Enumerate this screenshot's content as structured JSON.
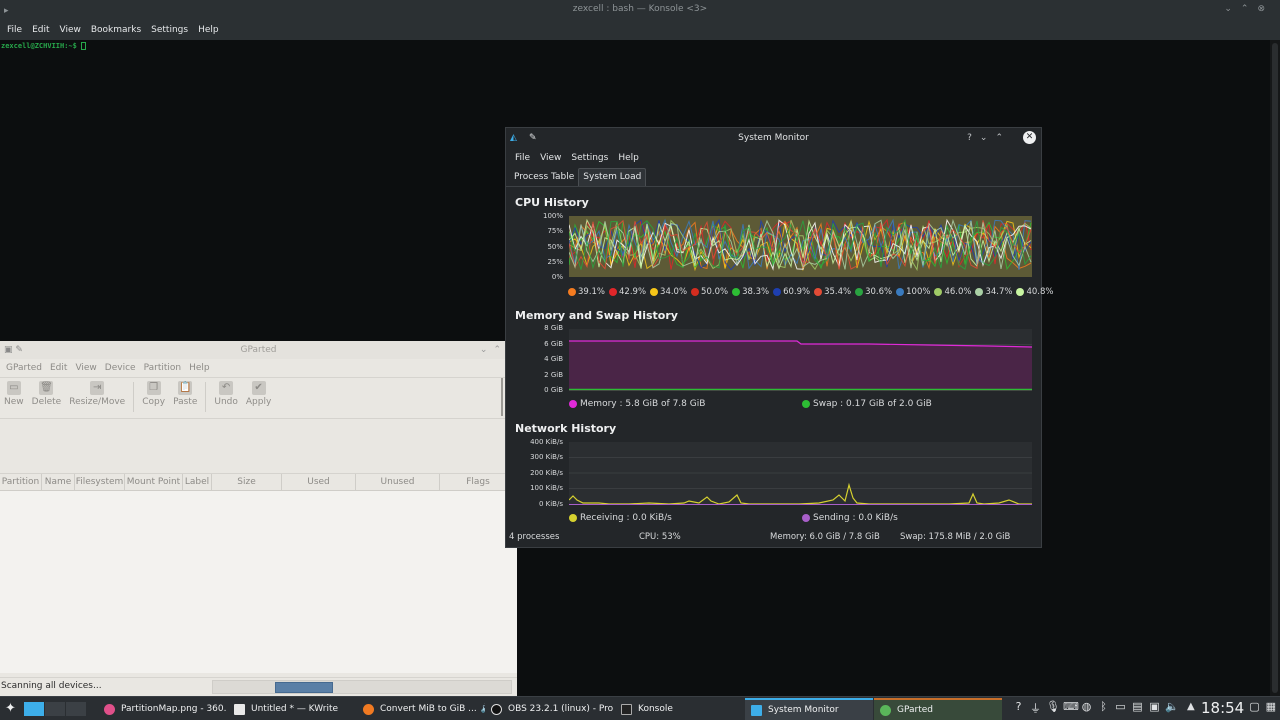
{
  "konsole": {
    "title": "zexcell : bash — Konsole <3>",
    "menu": [
      "File",
      "Edit",
      "View",
      "Bookmarks",
      "Settings",
      "Help"
    ],
    "prompt": "zexcell@ZCHVIIH:~$"
  },
  "gparted": {
    "title": "GParted",
    "menu": [
      "GParted",
      "Edit",
      "View",
      "Device",
      "Partition",
      "Help"
    ],
    "toolbar": [
      "New",
      "Delete",
      "Resize/Move",
      "Copy",
      "Paste",
      "Undo",
      "Apply"
    ],
    "columns": [
      "Partition",
      "Name",
      "Filesystem",
      "Mount Point",
      "Label",
      "Size",
      "Used",
      "Unused",
      "Flags"
    ],
    "status": "Scanning all devices..."
  },
  "sysmon": {
    "title": "System Monitor",
    "menu": [
      "File",
      "View",
      "Settings",
      "Help"
    ],
    "tabs": [
      "Process Table",
      "System Load"
    ],
    "cpu": {
      "title": "CPU History",
      "yticks": [
        "100%",
        "75%",
        "50%",
        "25%",
        "0%"
      ],
      "legend": [
        {
          "label": "39.1%",
          "color": "#f47b20"
        },
        {
          "label": "42.9%",
          "color": "#e0262a"
        },
        {
          "label": "34.0%",
          "color": "#f5c518"
        },
        {
          "label": "50.0%",
          "color": "#d42d1f"
        },
        {
          "label": "38.3%",
          "color": "#2dbd34"
        },
        {
          "label": "60.9%",
          "color": "#1e3fb0"
        },
        {
          "label": "35.4%",
          "color": "#e34b36"
        },
        {
          "label": "30.6%",
          "color": "#29a340"
        },
        {
          "label": "100%",
          "color": "#3a7bbf"
        },
        {
          "label": "46.0%",
          "color": "#9fca66"
        },
        {
          "label": "34.7%",
          "color": "#aad0a5"
        },
        {
          "label": "40.8%",
          "color": "#c8f5a1"
        }
      ]
    },
    "memory": {
      "title": "Memory and Swap History",
      "yticks": [
        "8 GiB",
        "6 GiB",
        "4 GiB",
        "2 GiB",
        "0 GiB"
      ],
      "memory_label": "Memory : 5.8 GiB of 7.8 GiB",
      "swap_label": "Swap : 0.17 GiB of 2.0 GiB",
      "memory_color": "#e02ad8",
      "swap_color": "#2dbd34"
    },
    "network": {
      "title": "Network History",
      "yticks": [
        "400 KiB/s",
        "300 KiB/s",
        "200 KiB/s",
        "100 KiB/s",
        "0 KiB/s"
      ],
      "receiving_label": "Receiving : 0.0 KiB/s",
      "sending_label": "Sending : 0.0 KiB/s",
      "receiving_color": "#d6d12f",
      "sending_color": "#a85fc9"
    },
    "status": {
      "processes": "4 processes",
      "cpu": "CPU: 53%",
      "memory": "Memory: 6.0 GiB / 7.8 GiB",
      "swap": "Swap: 175.8 MiB / 2.0 GiB"
    }
  },
  "taskbar": {
    "tasks": [
      "PartitionMap.png - 360...",
      "Untitled * — KWrite",
      "Convert MiB to GiB ...",
      "OBS 23.2.1 (linux) - Prof...",
      "Konsole",
      "System Monitor",
      "GParted"
    ],
    "clock": "18:54"
  }
}
